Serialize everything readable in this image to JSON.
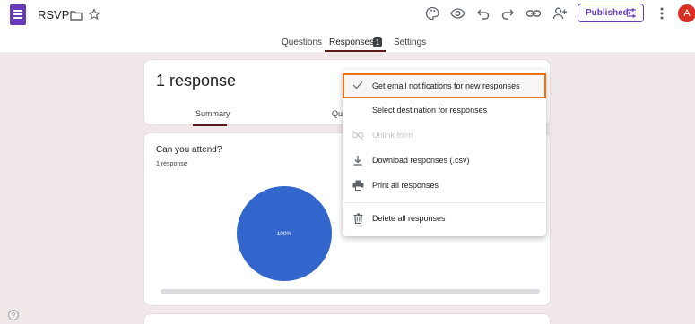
{
  "header": {
    "title": "RSVP",
    "publish_label": "Published",
    "avatar_initial": "A"
  },
  "tabs": {
    "questions": "Questions",
    "responses": "Responses",
    "responses_badge": "1",
    "settings": "Settings"
  },
  "summary": {
    "count_title": "1 response",
    "tab_summary": "Summary",
    "tab_question": "Qu"
  },
  "question": {
    "title": "Can you attend?",
    "count": "1 response"
  },
  "chart_data": {
    "type": "pie",
    "categories": [
      ""
    ],
    "values": [
      100
    ],
    "data_labels": [
      "100%"
    ],
    "colors": [
      "#3366cc"
    ]
  },
  "menu": {
    "items": [
      {
        "label": "Get email notifications for new responses",
        "icon": "check-icon",
        "state": "checked-highlighted"
      },
      {
        "label": "Select destination for responses",
        "icon": "",
        "state": "normal"
      },
      {
        "label": "Unlink form",
        "icon": "unlink-icon",
        "state": "disabled"
      },
      {
        "label": "Download responses (.csv)",
        "icon": "download-icon",
        "state": "normal"
      },
      {
        "label": "Print all responses",
        "icon": "print-icon",
        "state": "normal"
      },
      {
        "label": "Delete all responses",
        "icon": "trash-icon",
        "state": "normal"
      }
    ]
  },
  "help_icon_glyph": "?",
  "colors": {
    "brand": "#673ab7",
    "highlight_border": "#e8711a",
    "pie": "#3366cc",
    "avatar": "#d93025",
    "page_bg": "#f1e9e9"
  }
}
